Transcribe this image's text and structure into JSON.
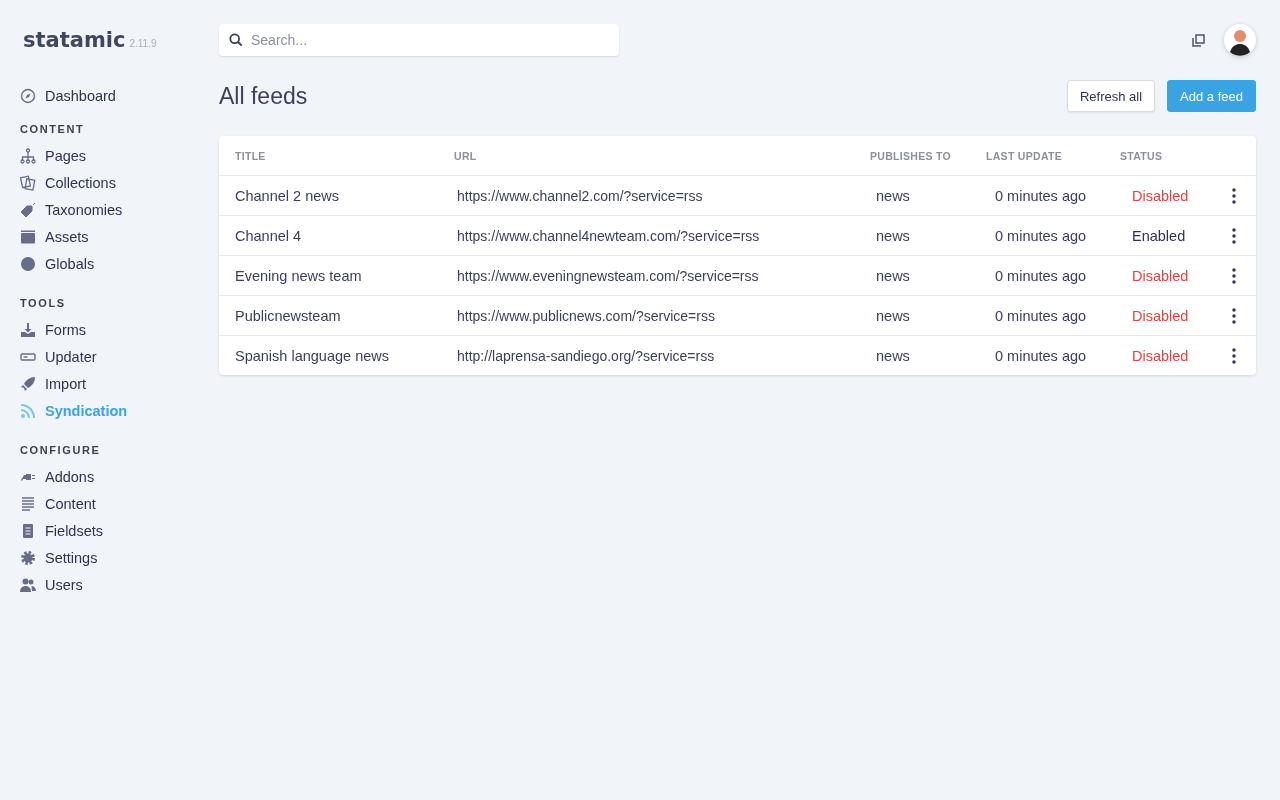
{
  "brand": {
    "name": "statamic",
    "version": "2.11.9"
  },
  "search": {
    "placeholder": "Search..."
  },
  "sidebar": {
    "top": [
      {
        "label": "Dashboard",
        "selected": false
      }
    ],
    "sections": [
      {
        "heading": "CONTENT",
        "items": [
          {
            "label": "Pages",
            "selected": false
          },
          {
            "label": "Collections",
            "selected": false
          },
          {
            "label": "Taxonomies",
            "selected": false
          },
          {
            "label": "Assets",
            "selected": false
          },
          {
            "label": "Globals",
            "selected": false
          }
        ]
      },
      {
        "heading": "TOOLS",
        "items": [
          {
            "label": "Forms",
            "selected": false
          },
          {
            "label": "Updater",
            "selected": false
          },
          {
            "label": "Import",
            "selected": false
          },
          {
            "label": "Syndication",
            "selected": true
          }
        ]
      },
      {
        "heading": "CONFIGURE",
        "items": [
          {
            "label": "Addons",
            "selected": false
          },
          {
            "label": "Content",
            "selected": false
          },
          {
            "label": "Fieldsets",
            "selected": false
          },
          {
            "label": "Settings",
            "selected": false
          },
          {
            "label": "Users",
            "selected": false
          }
        ]
      }
    ]
  },
  "page_title": "All feeds",
  "buttons": [
    {
      "label": "Refresh all",
      "kind": "secondary"
    },
    {
      "label": "Add a feed",
      "kind": "primary"
    }
  ],
  "table": {
    "columns": [
      "TITLE",
      "URL",
      "PUBLISHES TO",
      "LAST UPDATE",
      "STATUS"
    ],
    "rows": [
      {
        "title": "Channel 2 news",
        "url": "https://www.channel2.com/?service=rss",
        "publishes_to": "news",
        "last_update": "0 minutes ago",
        "status": "Disabled",
        "enabled": false
      },
      {
        "title": "Channel 4",
        "url": "https://www.channel4newteam.com/?service=rss",
        "publishes_to": "news",
        "last_update": "0 minutes ago",
        "status": "Enabled",
        "enabled": true
      },
      {
        "title": "Evening news team",
        "url": "https://www.eveningnewsteam.com/?service=rss",
        "publishes_to": "news",
        "last_update": "0 minutes ago",
        "status": "Disabled",
        "enabled": false
      },
      {
        "title": "Publicnewsteam",
        "url": "https://www.publicnews.com/?service=rss",
        "publishes_to": "news",
        "last_update": "0 minutes ago",
        "status": "Disabled",
        "enabled": false
      },
      {
        "title": "Spanish language news",
        "url": "http://laprensa-sandiego.org/?service=rss",
        "publishes_to": "news",
        "last_update": "0 minutes ago",
        "status": "Disabled",
        "enabled": false
      }
    ]
  }
}
